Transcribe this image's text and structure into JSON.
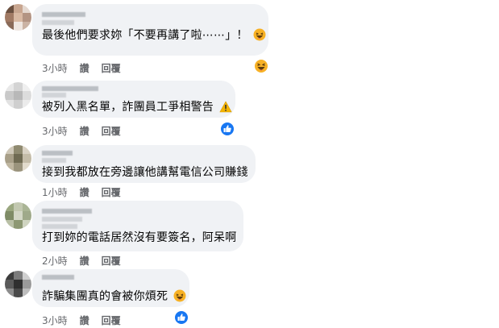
{
  "comments": [
    {
      "text": "最後他們要求妳「不要再講了啦⋯⋯」！",
      "time": "3小時",
      "like": "讚",
      "reply": "回覆",
      "reaction": "haha",
      "text_emoji": "haha"
    },
    {
      "text": "被列入黑名單，詐團員工爭相警告",
      "time": "3小時",
      "like": "讚",
      "reply": "回覆",
      "reaction": "like",
      "text_emoji": "warning"
    },
    {
      "text": "接到我都放在旁邊讓他講幫電信公司賺錢",
      "time": "1小時",
      "like": "讚",
      "reply": "回覆",
      "reaction": "",
      "text_emoji": ""
    },
    {
      "text": "打到妳的電話居然沒有要簽名，阿呆啊",
      "time": "2小時",
      "like": "讚",
      "reply": "回覆",
      "reaction": "",
      "text_emoji": ""
    },
    {
      "text": "詐騙集團真的會被你煩死",
      "time": "3小時",
      "like": "讚",
      "reply": "回覆",
      "reaction": "like",
      "text_emoji": "haha"
    }
  ],
  "colors": {
    "bubble": "#f0f2f5",
    "meta_text": "#65676b",
    "like_blue": "#1877f2",
    "haha_yellow": "#f7b125"
  }
}
